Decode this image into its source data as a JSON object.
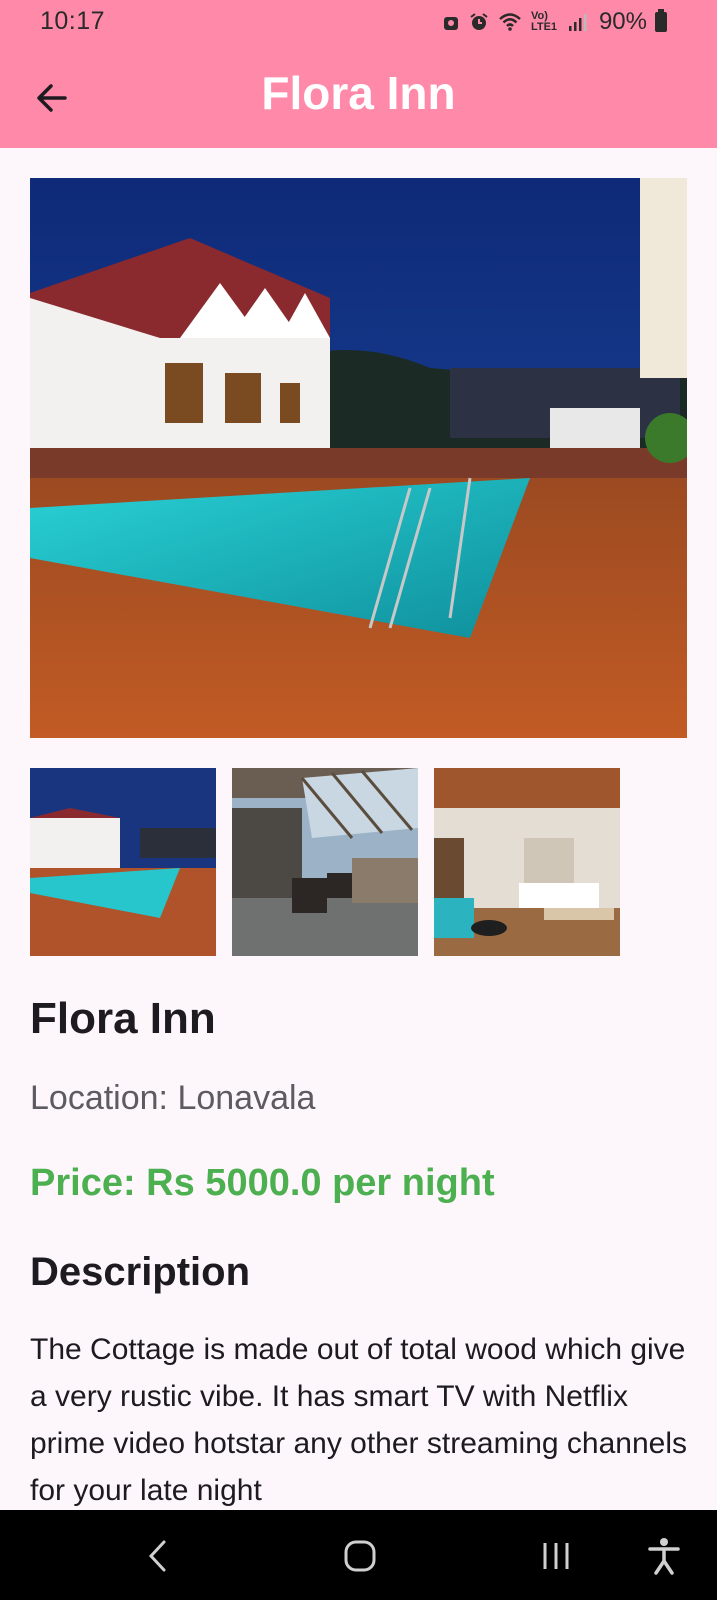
{
  "status_bar": {
    "time": "10:17",
    "network_label": "Vo) LTE1",
    "battery_percent": "90%"
  },
  "app_bar": {
    "title": "Flora Inn",
    "back_icon": "arrow-left-icon"
  },
  "gallery": {
    "main_image": "hotel-pool-night-photo",
    "thumbnails": [
      "hotel-pool-night-photo",
      "balcony-lounge-photo",
      "bedroom-interior-photo"
    ]
  },
  "details": {
    "name": "Flora Inn",
    "location": "Location: Lonavala",
    "price": "Price: Rs 5000.0 per night",
    "description_heading": "Description",
    "description": "The Cottage is made out of total wood which give a very rustic vibe. It has smart TV with Netflix prime video hotstar any other streaming channels for your late night"
  },
  "colors": {
    "app_bar": "#ff89a9",
    "price": "#4caf50",
    "background": "#fdf7fc"
  },
  "nav_bar": {
    "icons": [
      "back-nav-icon",
      "home-nav-icon",
      "recents-nav-icon",
      "accessibility-icon"
    ]
  }
}
